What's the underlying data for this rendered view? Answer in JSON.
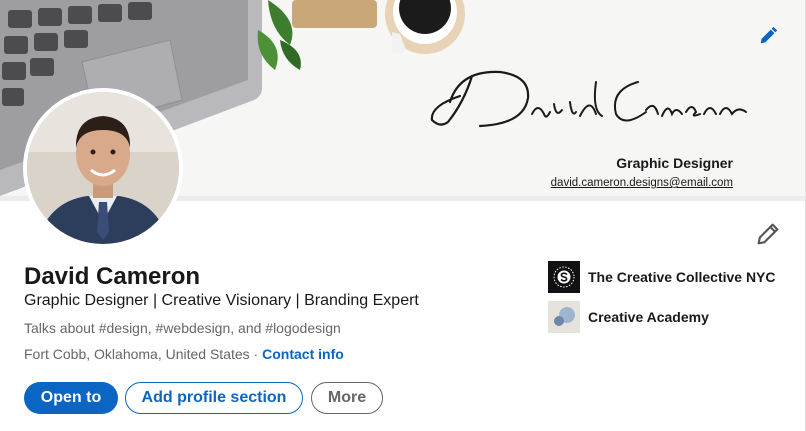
{
  "banner": {
    "signature": "David Cameron",
    "title": "Graphic Designer",
    "email": "david.cameron.designs@email.com"
  },
  "profile": {
    "name": "David Cameron",
    "headline": "Graphic Designer | Creative Visionary | Branding Expert",
    "talks_about": "Talks about #design, #webdesign, and #logodesign",
    "location": "Fort Cobb, Oklahoma, United States",
    "location_separator": " · ",
    "contact_info": "Contact info"
  },
  "actions": {
    "open_to": "Open to",
    "add_profile_section": "Add profile section",
    "more": "More"
  },
  "organizations": [
    {
      "name": "The Creative Collective NYC",
      "icon": "company-logo"
    },
    {
      "name": "Creative Academy",
      "icon": "school-logo"
    }
  ],
  "colors": {
    "primary": "#0a66c2",
    "text": "#191919",
    "muted": "#666666"
  }
}
